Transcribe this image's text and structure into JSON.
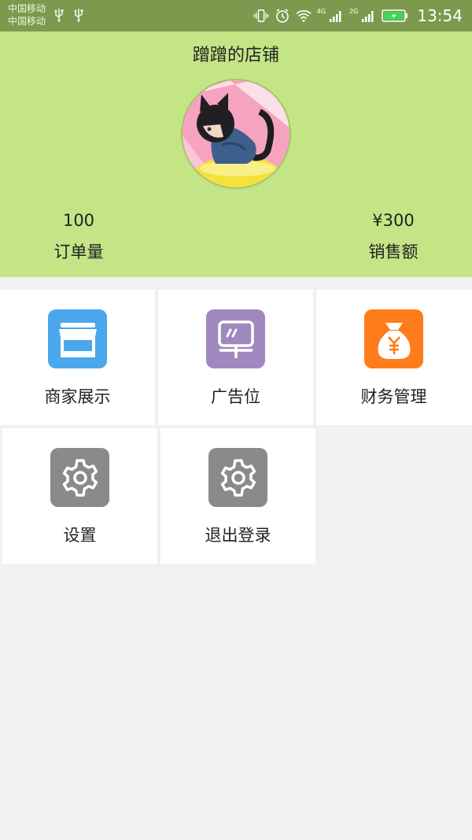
{
  "status_bar": {
    "carrier_1": "中国移动",
    "carrier_2": "中国移动",
    "net_1": "4G",
    "net_2": "2G",
    "time": "13:54",
    "icons": [
      "usb-icon",
      "usb-icon",
      "vibrate-icon",
      "alarm-icon",
      "wifi-icon",
      "signal-icon",
      "signal-icon",
      "battery-icon"
    ]
  },
  "header": {
    "shop_name": "蹭蹭的店铺",
    "avatar": "cat-eared-boy-avatar",
    "stats": {
      "orders_value": "100",
      "orders_label": "订单量",
      "sales_value": "¥300",
      "sales_label": "销售额"
    }
  },
  "grid": {
    "items": [
      {
        "label": "商家展示",
        "icon": "storefront-icon",
        "color": "#4aa7ec"
      },
      {
        "label": "广告位",
        "icon": "billboard-icon",
        "color": "#a088be"
      },
      {
        "label": "财务管理",
        "icon": "money-bag-icon",
        "color": "#ff7c1a"
      },
      {
        "label": "设置",
        "icon": "gear-icon",
        "color": "#8a8a8a"
      },
      {
        "label": "退出登录",
        "icon": "gear-icon",
        "color": "#8a8a8a"
      }
    ]
  },
  "colors": {
    "status_bar": "#7c9a4e",
    "header_bg": "#c3e586",
    "page_bg": "#f1f1f1"
  }
}
